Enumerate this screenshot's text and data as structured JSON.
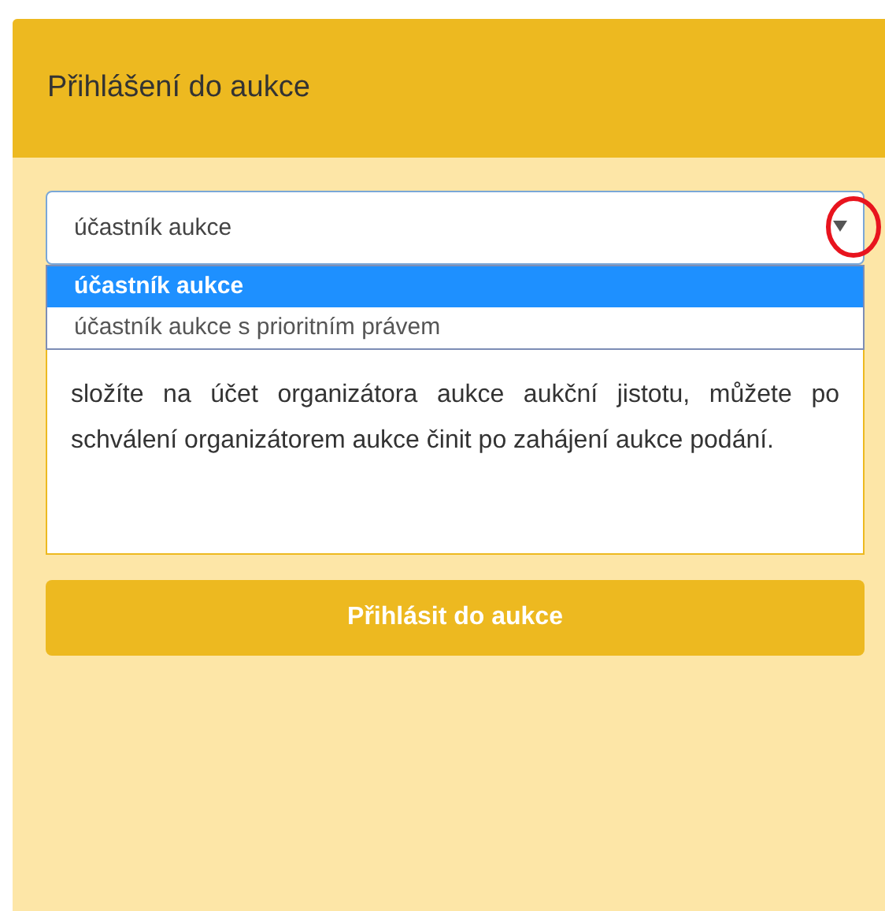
{
  "panel": {
    "title": "Přihlášení do aukce"
  },
  "select": {
    "value": "účastník aukce",
    "expanded": true,
    "options": [
      {
        "label": "účastník aukce",
        "selected": true
      },
      {
        "label": "účastník aukce s prioritním právem",
        "selected": false
      }
    ]
  },
  "info_text": "složíte na účet organizátora aukce aukční jistotu, můžete po schválení organizátorem aukce činit po zahájení aukce podání.",
  "button": {
    "label": "Přihlásit do aukce"
  }
}
